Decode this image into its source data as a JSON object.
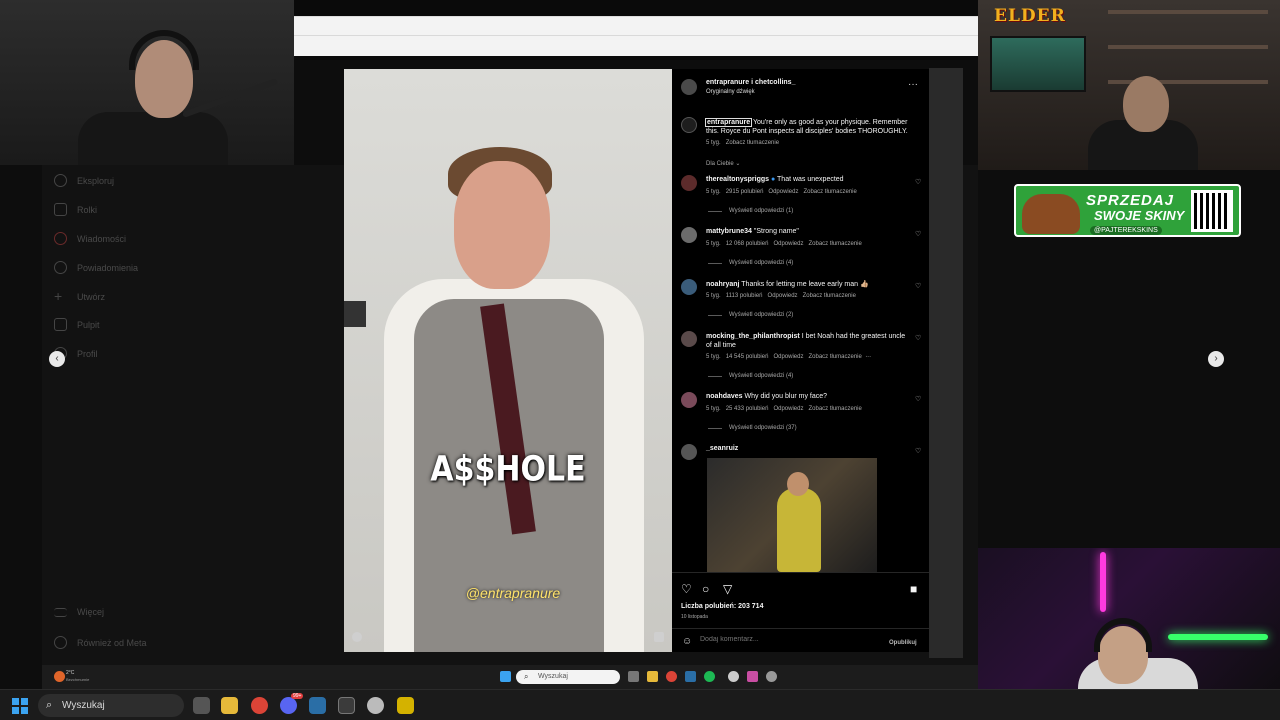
{
  "stream": {
    "logo_text": "ELDER",
    "sponsor": {
      "line1": "SPRZEDAJ",
      "line2": "SWOJE SKINY",
      "handle": "@PAJTEREKSKINS"
    }
  },
  "sidebar": {
    "items": [
      {
        "label": "Eksploruj",
        "icon": "compass-icon"
      },
      {
        "label": "Rolki",
        "icon": "reels-icon"
      },
      {
        "label": "Wiadomości",
        "icon": "messenger-icon"
      },
      {
        "label": "Powiadomienia",
        "icon": "heart-icon"
      },
      {
        "label": "Utwórz",
        "icon": "plus-icon"
      },
      {
        "label": "Pulpit",
        "icon": "dashboard-icon"
      },
      {
        "label": "Profil",
        "icon": "profile-icon"
      }
    ],
    "more_label": "Więcej",
    "meta_label": "Również od Meta"
  },
  "video": {
    "overlay_word": "A$$HOLE",
    "overlay_handle": "@entrapranure"
  },
  "post": {
    "authors": "entrapranure i chetcollins_",
    "audio": "Oryginalny dźwięk",
    "caption_user": "entrapranure",
    "caption_text": "You're only as good as your physique. Remember this. Royce du Pont inspects all disciples' bodies THOROUGHLY.",
    "caption_age": "5 tyg.",
    "caption_translate": "Zobacz tłumaczenie",
    "filter_label": "Dla Ciebie",
    "likes_label": "Liczba polubień: 203 714",
    "date": "10 listopada",
    "comment_placeholder": "Dodaj komentarz...",
    "publish_label": "Opublikuj"
  },
  "comments": [
    {
      "user": "therealtonyspriggs",
      "verified": true,
      "text": "That was unexpected",
      "age": "5 tyg.",
      "likes": "2915 polubień",
      "reply": "Odpowiedz",
      "translate": "Zobacz tłumaczenie",
      "replies": "Wyświetl odpowiedzi (1)"
    },
    {
      "user": "mattybrune34",
      "verified": false,
      "text": "\"Strong name\"",
      "age": "5 tyg.",
      "likes": "12 068 polubień",
      "reply": "Odpowiedz",
      "translate": "Zobacz tłumaczenie",
      "replies": "Wyświetl odpowiedzi (4)"
    },
    {
      "user": "noahryanj",
      "verified": false,
      "text": "Thanks for letting me leave early man 👍🏼",
      "age": "5 tyg.",
      "likes": "1113 polubień",
      "reply": "Odpowiedz",
      "translate": "Zobacz tłumaczenie",
      "replies": "Wyświetl odpowiedzi (2)"
    },
    {
      "user": "mocking_the_philanthropist",
      "verified": false,
      "text": "I bet Noah had the greatest uncle of all time",
      "age": "5 tyg.",
      "likes": "14 545 polubień",
      "reply": "Odpowiedz",
      "translate": "Zobacz tłumaczenie",
      "replies": "Wyświetl odpowiedzi (4)"
    },
    {
      "user": "noahdaves",
      "verified": false,
      "text": "Why did you blur my face?",
      "age": "5 tyg.",
      "likes": "25 433 polubień",
      "reply": "Odpowiedz",
      "translate": "Zobacz tłumaczenie",
      "replies": "Wyświetl odpowiedzi (37)"
    },
    {
      "user": "_seanruiz",
      "verified": false,
      "text": "",
      "age": "",
      "likes": "",
      "reply": "",
      "translate": "",
      "replies": ""
    }
  ],
  "inner_taskbar": {
    "weather": "2°C",
    "weather_desc": "Bezchmurnie",
    "search_placeholder": "Wyszukaj"
  },
  "taskbar": {
    "search_placeholder": "Wyszukaj",
    "badge": "99+"
  },
  "colors": {
    "instagram_bg": "#121212",
    "panel_bg": "#000000",
    "sponsor_green": "#2fa23a",
    "accent_blue": "#3ba3f0"
  }
}
